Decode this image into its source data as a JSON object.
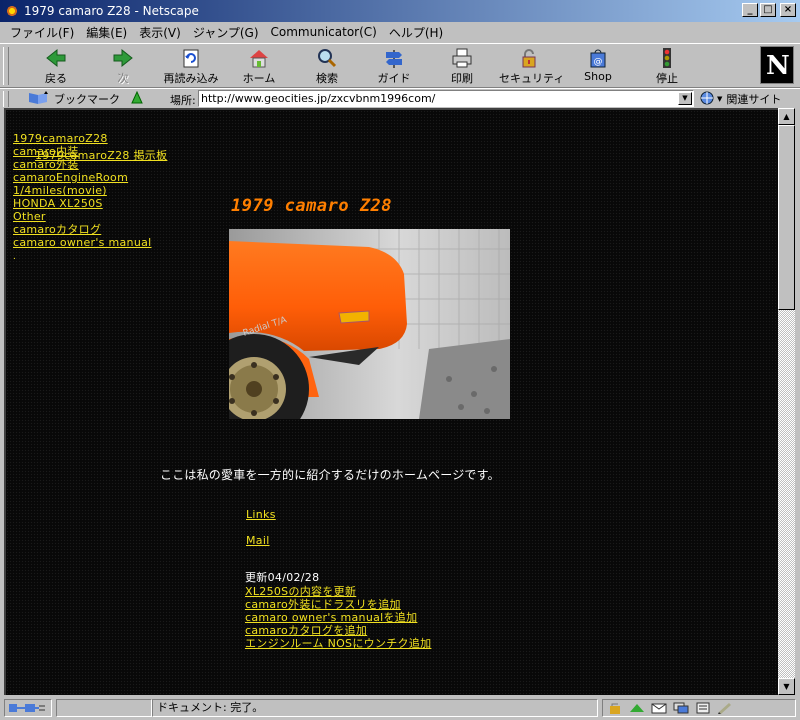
{
  "window": {
    "title": "1979 camaro Z28 - Netscape",
    "minimize": "_",
    "maximize": "□",
    "close": "×"
  },
  "menu": [
    "ファイル(F)",
    "編集(E)",
    "表示(V)",
    "ジャンプ(G)",
    "Communicator(C)",
    "ヘルプ(H)"
  ],
  "toolbar": {
    "back": "戻る",
    "forward": "次",
    "reload": "再読み込み",
    "home": "ホーム",
    "search": "検索",
    "guide": "ガイド",
    "print": "印刷",
    "security": "セキュリティ",
    "shop": "Shop",
    "stop": "停止"
  },
  "location": {
    "bookmark_label": "ブックマーク",
    "label": "場所:",
    "url": "http://www.geocities.jp/zxcvbnm1996com/",
    "related_label": "関連サイト"
  },
  "page": {
    "nav": [
      "1979camaroZ28",
      "camaro内装",
      "camaro外装",
      "camaroEngineRoom",
      "1/4miles(movie)",
      "HONDA XL250S",
      "Other",
      "camaroカタログ",
      "camaro owner's manual"
    ],
    "nav_overlap": "1979camaroZ28 掲示板",
    "nav_dot": ".",
    "title": "1979 camaro Z28",
    "intro": "ここは私の愛車を一方的に紹介するだけのホームページです。",
    "links_label": "Links",
    "mail_label": "Mail",
    "update_date": "更新04/02/28",
    "updates": [
      "XL250Sの内容を更新",
      "camaro外装にドラスリを追加",
      "camaro owner's manualを追加",
      "camaroカタログを追加",
      "エンジンルーム NOSにウンチク追加"
    ],
    "tire_text": "Radial T/A"
  },
  "status": {
    "text": "ドキュメント: 完了。"
  },
  "colors": {
    "link": "#f0e020",
    "title": "#ff7f00",
    "car": "#ff6a10"
  }
}
